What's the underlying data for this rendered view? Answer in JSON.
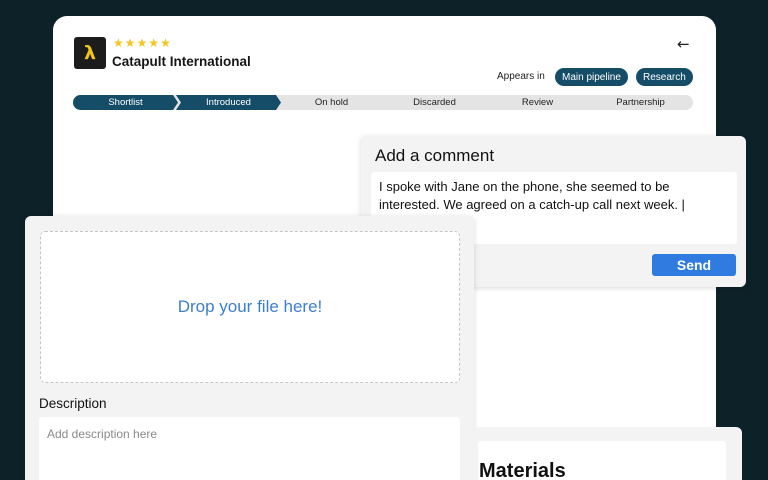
{
  "company": {
    "name": "Catapult International",
    "logo_glyph": "λ",
    "rating_stars": [
      "★",
      "★",
      "★",
      "★",
      "★"
    ],
    "star_color": "#f4c621"
  },
  "header": {
    "back_glyph": "←",
    "appears_label": "Appears in",
    "tags": [
      "Main pipeline",
      "Research"
    ]
  },
  "pipeline": {
    "stages": [
      "Shortlist",
      "Introduced",
      "On hold",
      "Discarded",
      "Review",
      "Partnership"
    ],
    "active_color": "#154d68"
  },
  "comment": {
    "title": "Add a comment",
    "text": "I spoke with Jane on the phone, she seemed to be interested. We agreed on a catch-up call next week. |",
    "send_label": "Send",
    "send_color": "#2f7be0"
  },
  "upload": {
    "drop_text": "Drop your file here!",
    "description_label": "Description",
    "description_placeholder": "Add description here"
  },
  "materials": {
    "title": "Materials"
  }
}
